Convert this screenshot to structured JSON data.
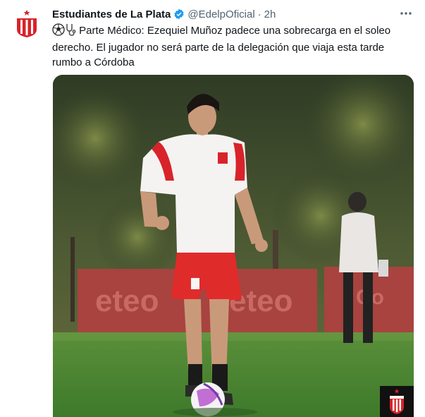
{
  "tweet": {
    "author_name": "Estudiantes de La Plata",
    "handle": "@EdelpOficial",
    "separator": "·",
    "time": "2h",
    "text_line1": "Parte Médico: Ezequiel Muñoz padece una sobrecarga en el soleo",
    "text_line2": "derecho. El jugador no será parte de la delegación que viaja esta tarde",
    "text_line3": "rumbo a Córdoba"
  },
  "colors": {
    "brand_red": "#d8232a",
    "verified_blue": "#1d9bf0",
    "secondary_text": "#536471"
  },
  "icons": [
    "club-crest-icon",
    "verified-badge-icon",
    "more-options-icon",
    "soccer-ball-icon",
    "stethoscope-icon"
  ]
}
